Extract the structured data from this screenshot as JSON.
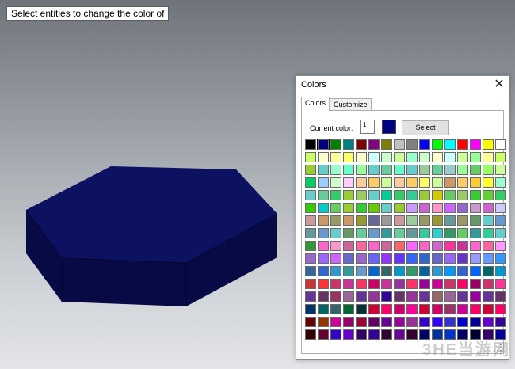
{
  "prompt": {
    "text": "Select entities to change the color of"
  },
  "model": {
    "color": "#0d1161",
    "side_color": "#080a45"
  },
  "dialog": {
    "title": "Colors",
    "close_glyph": "✕",
    "tabs": [
      {
        "label": "Colors",
        "active": true
      },
      {
        "label": "Customize",
        "active": false
      }
    ],
    "current_color_label": "Current color:",
    "current_color_value": "1",
    "current_color": "#000080",
    "select_button": "Select",
    "palette": [
      [
        "#000000",
        "#000080",
        "#008000",
        "#008080",
        "#800000",
        "#800080",
        "#808000",
        "#c0c0c0",
        "#808080",
        "#0000ff",
        "#00ff00",
        "#00ffff",
        "#ff0000",
        "#ff00ff",
        "#ffff00",
        "#ffffff"
      ],
      [
        "#ccff66",
        "#ffffcc",
        "#ffff99",
        "#ffff66",
        "#ffffcc",
        "#ccffff",
        "#ccffcc",
        "#ccff99",
        "#99ffcc",
        "#ccffcc",
        "#ffffcc",
        "#ccffff",
        "#ccff99",
        "#99ff99",
        "#ffff99",
        "#ccff66"
      ],
      [
        "#99cc33",
        "#66cccc",
        "#99ffcc",
        "#66ffcc",
        "#99ff99",
        "#66cccc",
        "#66cc99",
        "#66ffcc",
        "#66cccc",
        "#99cc99",
        "#66cc99",
        "#99cccc",
        "#99ff99",
        "#66cc66",
        "#99ff66",
        "#ccff99"
      ],
      [
        "#00cc66",
        "#99ccff",
        "#ccffcc",
        "#ffccff",
        "#ffcc99",
        "#ffcc66",
        "#ccff99",
        "#ffcc99",
        "#ffcc66",
        "#ffff66",
        "#ccff99",
        "#cc9966",
        "#ffcc66",
        "#ffcc33",
        "#ffff33",
        "#99ffcc"
      ],
      [
        "#66cccc",
        "#66cc99",
        "#33cc66",
        "#99cc33",
        "#99cc66",
        "#66cccc",
        "#00cc99",
        "#33cc66",
        "#33cc99",
        "#99cc33",
        "#cccc00",
        "#66cc66",
        "#99cc66",
        "#33cc33",
        "#66cc33",
        "#33cc66"
      ],
      [
        "#33cc00",
        "#00cccc",
        "#66cc66",
        "#99cc33",
        "#33cc33",
        "#66cc00",
        "#66cccc",
        "#99cc33",
        "#cc99ff",
        "#cc66cc",
        "#ff99cc",
        "#cc66ff",
        "#9966cc",
        "#cc99cc",
        "#cc66cc",
        "#ccccff"
      ],
      [
        "#cc9999",
        "#cc9966",
        "#999966",
        "#cc9966",
        "#999933",
        "#666699",
        "#999999",
        "#cc9999",
        "#99cc99",
        "#999966",
        "#999933",
        "#669999",
        "#999966",
        "#669966",
        "#66cccc",
        "#6699cc"
      ],
      [
        "#669999",
        "#6699cc",
        "#66cccc",
        "#669966",
        "#66cc99",
        "#6699cc",
        "#339999",
        "#66cc99",
        "#669999",
        "#33cc99",
        "#33cccc",
        "#339966",
        "#66cc66",
        "#339999",
        "#33cc99",
        "#66cccc"
      ],
      [
        "#339933",
        "#ff66cc",
        "#ff99cc",
        "#cc6699",
        "#ff6699",
        "#ff66cc",
        "#cc6699",
        "#ff6666",
        "#ff66ff",
        "#ff66cc",
        "#cc66cc",
        "#ff3399",
        "#cc3399",
        "#ff66cc",
        "#ff6699",
        "#ff99ff"
      ],
      [
        "#9966cc",
        "#9966ff",
        "#cc66ff",
        "#6666cc",
        "#9966cc",
        "#6666ff",
        "#9933ff",
        "#6633ff",
        "#3366ff",
        "#3366cc",
        "#6666cc",
        "#9966ff",
        "#6633cc",
        "#9999ff",
        "#6699ff",
        "#3399ff"
      ],
      [
        "#336699",
        "#3366cc",
        "#3399cc",
        "#339999",
        "#6699cc",
        "#0066cc",
        "#336666",
        "#0099cc",
        "#339966",
        "#006699",
        "#3399cc",
        "#0099ff",
        "#3366cc",
        "#0066ff",
        "#006666",
        "#0099cc"
      ],
      [
        "#cc3333",
        "#ff3333",
        "#cc3366",
        "#cc3399",
        "#ff3366",
        "#cc0066",
        "#cc3399",
        "#993399",
        "#ff3366",
        "#990099",
        "#cc0099",
        "#cc3366",
        "#ff0066",
        "#990066",
        "#cc3366",
        "#ff3399"
      ],
      [
        "#663399",
        "#663366",
        "#993366",
        "#996699",
        "#663399",
        "#993399",
        "#330099",
        "#663366",
        "#993399",
        "#663399",
        "#996666",
        "#996699",
        "#663399",
        "#990099",
        "#663399",
        "#663366"
      ],
      [
        "#003366",
        "#006666",
        "#336666",
        "#006633",
        "#003333",
        "#cc0033",
        "#ff0066",
        "#cc0066",
        "#ff0099",
        "#cc0033",
        "#cc0066",
        "#993366",
        "#cc0099",
        "#ff0066",
        "#cc0033",
        "#ff0066"
      ],
      [
        "#660000",
        "#993300",
        "#cc0099",
        "#990066",
        "#990033",
        "#660066",
        "#660099",
        "#990099",
        "#993399",
        "#3300cc",
        "#3300ff",
        "#3333cc",
        "#0000cc",
        "#000099",
        "#6600cc",
        "#330099"
      ],
      [
        "#330000",
        "#660033",
        "#3300cc",
        "#6600cc",
        "#330066",
        "#330099",
        "#330033",
        "#660099",
        "#330033",
        "#000066",
        "#003399",
        "#0033cc",
        "#000066",
        "#000033",
        "#330066",
        "#000099"
      ]
    ]
  },
  "watermark": {
    "text": "3HE当游网"
  }
}
